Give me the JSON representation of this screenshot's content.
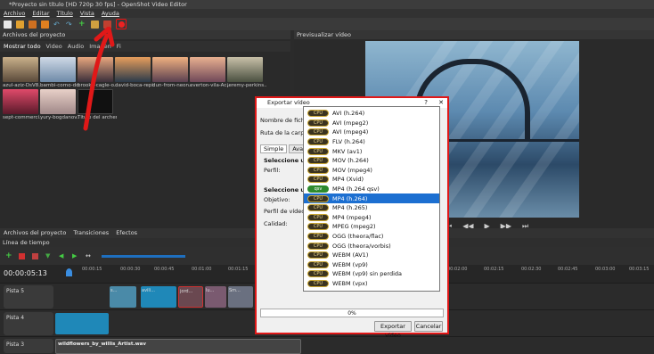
{
  "window": {
    "title": "*Proyecto sin título [HD 720p 30 fps] - OpenShot Video Editor"
  },
  "menu": [
    "Archivo",
    "Editar",
    "Título",
    "Vista",
    "Ayuda"
  ],
  "project_files": {
    "header": "Archivos del proyecto",
    "tabs": [
      "Mostrar todo",
      "Video",
      "Audio",
      "Imagen",
      "Fi"
    ],
    "items": [
      "azul-aziz-DsV8...",
      "bambi-corno-dd...",
      "brooke-cagle-o...",
      "david-boca-repi...",
      "dun-from-neon...",
      "everton-vila-Ac...",
      "jeremy-perkins...",
      "sept-commerci...",
      "yury-bogdanov...",
      "Título del archer..."
    ]
  },
  "preview": {
    "header": "Previsualizar vídeo"
  },
  "bottom_tabs": [
    "Archivos del proyecto",
    "Transiciones",
    "Efectos"
  ],
  "timeline": {
    "header": "Línea de tiempo",
    "timecode": "00:00:05:13",
    "ticks": [
      "00:00:15",
      "00:00:30",
      "00:00:45",
      "00:01:00",
      "00:01:15",
      "00:02:00",
      "00:02:15",
      "00:02:30",
      "00:02:45",
      "00:03:00",
      "00:03:15",
      "00:03:30",
      "00:03:45"
    ],
    "tracks": [
      {
        "name": "Pista 5"
      },
      {
        "name": "Pista 4"
      },
      {
        "name": "Pista 3"
      }
    ],
    "clips": {
      "audio_title": "wildflowers_by_willis_Artist.wav",
      "clip_a": "s...",
      "clip_b": "avili...",
      "clip_c": "jord...",
      "clip_d": "lu...",
      "clip_e": "Sm..."
    }
  },
  "dialog": {
    "title": "Exportar vídeo",
    "help": "?",
    "close": "✕",
    "file_name_label": "Nombre de fichero:",
    "folder_label": "Ruta de la carpeta:",
    "tabs": [
      "Simple",
      "Avanz"
    ],
    "select_label_1": "Seleccione un",
    "profile_label": "Perfil:",
    "select_label_2": "Seleccione una",
    "target_label": "Objetivo:",
    "video_profile_label": "Perfil de vídeo:",
    "quality_label": "Calidad:",
    "progress": "0%",
    "export_button": "Exportar vídeo",
    "cancel_button": "Cancelar"
  },
  "format_dropdown": {
    "selected_index": 9,
    "items": [
      {
        "badge": "CPU",
        "label": "AVI (h.264)"
      },
      {
        "badge": "CPU",
        "label": "AVI (mpeg2)"
      },
      {
        "badge": "CPU",
        "label": "AVI (mpeg4)"
      },
      {
        "badge": "CPU",
        "label": "FLV (h.264)"
      },
      {
        "badge": "CPU",
        "label": "MKV (av1)"
      },
      {
        "badge": "CPU",
        "label": "MOV (h.264)"
      },
      {
        "badge": "CPU",
        "label": "MOV (mpeg4)"
      },
      {
        "badge": "CPU",
        "label": "MP4 (Xvid)"
      },
      {
        "badge": "qsv",
        "label": "MP4 (h.264 qsv)"
      },
      {
        "badge": "CPU",
        "label": "MP4 (h.264)"
      },
      {
        "badge": "CPU",
        "label": "MP4 (h.265)"
      },
      {
        "badge": "CPU",
        "label": "MP4 (mpeg4)"
      },
      {
        "badge": "CPU",
        "label": "MPEG (mpeg2)"
      },
      {
        "badge": "CPU",
        "label": "OGG (theora/flac)"
      },
      {
        "badge": "CPU",
        "label": "OGG (theora/vorbis)"
      },
      {
        "badge": "CPU",
        "label": "WEBM (AV1)"
      },
      {
        "badge": "CPU",
        "label": "WEBM (vp9)"
      },
      {
        "badge": "CPU",
        "label": "WEBM (vp9) sin perdida"
      },
      {
        "badge": "CPU",
        "label": "WEBM (vpx)"
      }
    ]
  },
  "colors": {
    "highlight": "#e01818",
    "selection": "#1c6fd1",
    "timeline_accent": "#3a8de0"
  }
}
